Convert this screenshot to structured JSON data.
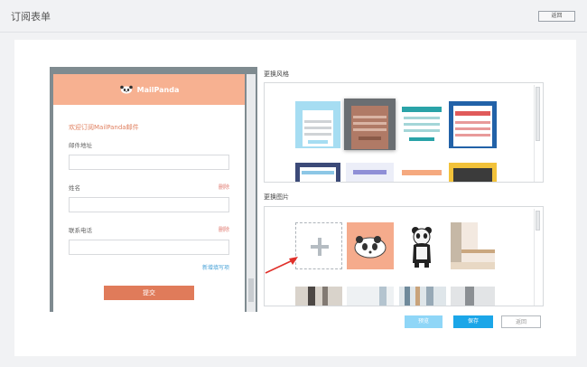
{
  "header": {
    "title": "订阅表单",
    "back_label": "返回"
  },
  "preview": {
    "brand": "MailPanda",
    "welcome": "欢迎订阅MailPanda邮件",
    "fields": [
      {
        "label": "邮件地址",
        "delete": ""
      },
      {
        "label": "姓名",
        "delete": "删除"
      },
      {
        "label": "联系电话",
        "delete": "删除"
      }
    ],
    "add_field": "新增填写项",
    "submit": "提交"
  },
  "style_section": {
    "title": "更换风格"
  },
  "image_section": {
    "title": "更换图片"
  },
  "actions": {
    "preview": "预览",
    "save": "保存",
    "back": "返回"
  },
  "colors": {
    "accent": "#f7b191",
    "submit": "#e07b5a",
    "primary": "#1ba6e8",
    "phone_frame": "#7f8b90"
  }
}
